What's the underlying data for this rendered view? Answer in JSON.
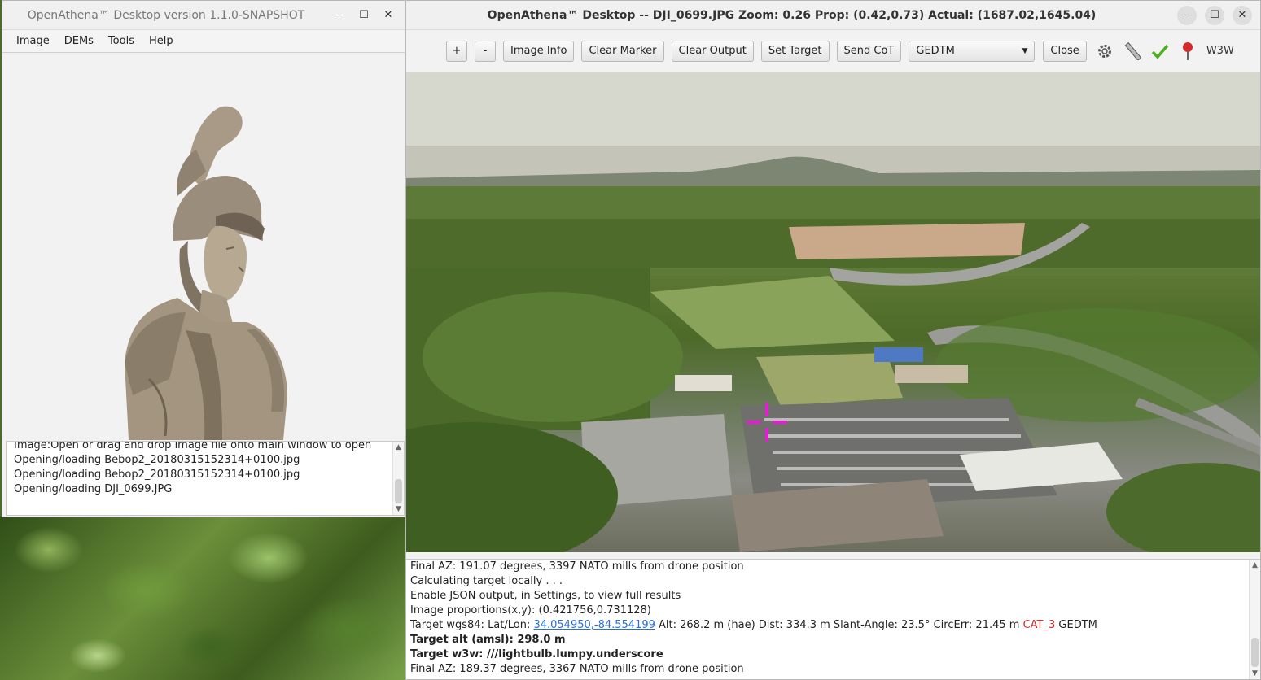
{
  "left_window": {
    "title": "OpenAthena™ Desktop version 1.1.0-SNAPSHOT",
    "controls": {
      "minimize": "–",
      "maximize": "☐",
      "close": "✕"
    },
    "menu": [
      "Image",
      "DEMs",
      "Tools",
      "Help"
    ],
    "console": [
      "Image:Open or drag and drop image file onto main window to open",
      "Opening/loading Bebop2_20180315152314+0100.jpg",
      "Opening/loading Bebop2_20180315152314+0100.jpg",
      "Opening/loading DJI_0699.JPG"
    ]
  },
  "right_window": {
    "title": "OpenAthena™ Desktop -- DJI_0699.JPG Zoom: 0.26 Prop: (0.42,0.73) Actual: (1687.02,1645.04)",
    "controls": {
      "minimize": "–",
      "maximize": "☐",
      "close": "✕"
    },
    "toolbar": {
      "zoom_in": "+",
      "zoom_out": "-",
      "image_info": "Image Info",
      "clear_marker": "Clear Marker",
      "clear_output": "Clear Output",
      "set_target": "Set Target",
      "send_cot": "Send CoT",
      "dem_select": "GEDTM",
      "close": "Close",
      "w3w": "W3W"
    },
    "icons": {
      "settings": "gear-icon",
      "ruler": "ruler-icon",
      "check": "check-icon",
      "pin": "map-pin-icon"
    },
    "marker_color": "#e020d0",
    "console": {
      "line1": "Final AZ: 191.07 degrees, 3397 NATO mills from drone position",
      "line2": "Calculating target locally . . .",
      "line3": "Enable JSON output, in Settings, to view full results",
      "line4": "Image proportions(x,y): (0.421756,0.731128)",
      "line5_prefix": "Target wgs84: Lat/Lon: ",
      "line5_link": "34.054950,-84.554199",
      "line5_mid": "  Alt: 268.2 m (hae) Dist: 334.3 m  Slant-Angle: 23.5° CircErr: 21.45 m ",
      "line5_cat": "CAT_3",
      "line5_suffix": " GEDTM",
      "line6": "Target alt (amsl): 298.0 m",
      "line7": "Target w3w: ///lightbulb.lumpy.underscore",
      "line8": "Final AZ: 189.37 degrees, 3367 NATO mills from drone position"
    }
  }
}
